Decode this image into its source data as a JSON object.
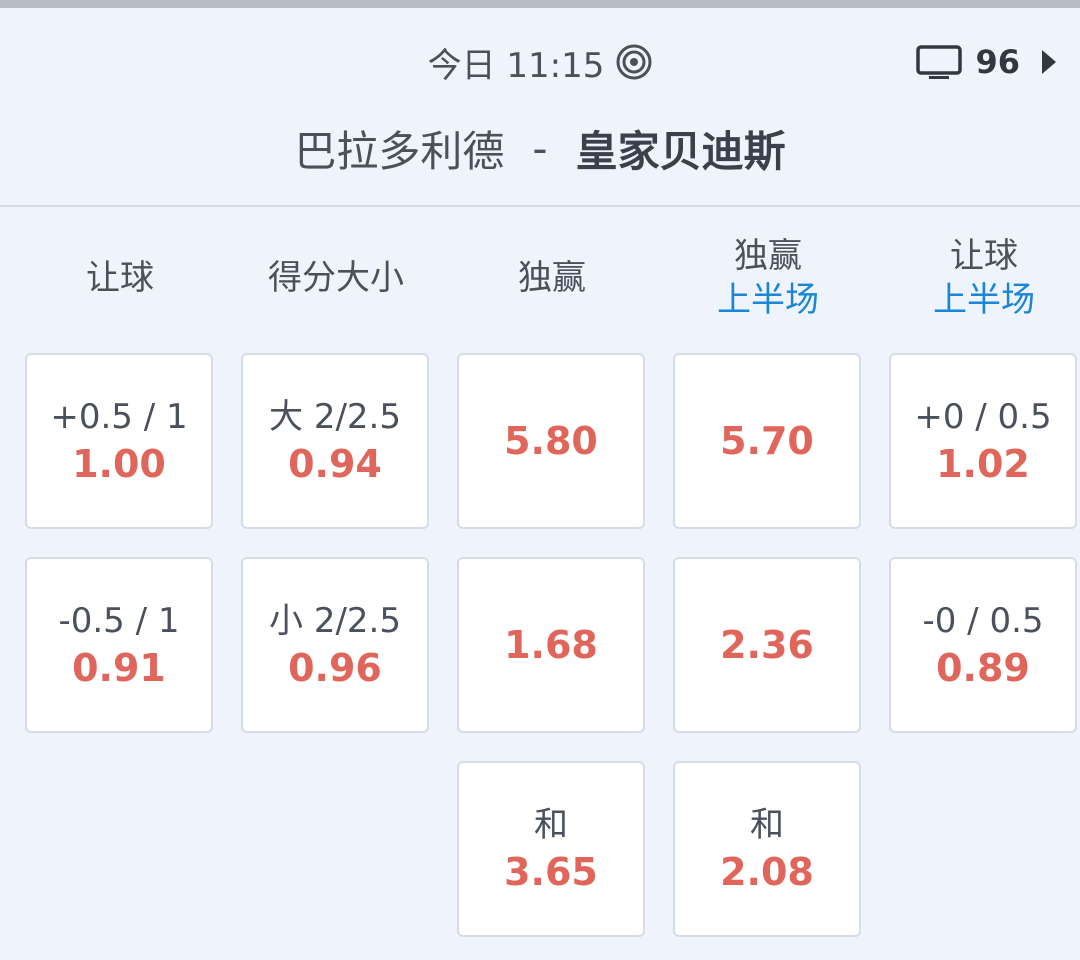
{
  "header": {
    "time": "今日 11:15",
    "tv_count": "96",
    "home_team": "巴拉多利德",
    "separator": "-",
    "away_team": "皇家贝迪斯"
  },
  "columns": [
    {
      "title": "让球",
      "sub": ""
    },
    {
      "title": "得分大小",
      "sub": ""
    },
    {
      "title": "独赢",
      "sub": ""
    },
    {
      "title": "独赢",
      "sub": "上半场"
    },
    {
      "title": "让球",
      "sub": "上半场"
    }
  ],
  "cells": {
    "r0": [
      {
        "line": "+0.5 / 1",
        "odds": "1.00"
      },
      {
        "line": "大 2/2.5",
        "odds": "0.94"
      },
      {
        "line": "",
        "odds": "5.80"
      },
      {
        "line": "",
        "odds": "5.70"
      },
      {
        "line": "+0 / 0.5",
        "odds": "1.02"
      }
    ],
    "r1": [
      {
        "line": "-0.5 / 1",
        "odds": "0.91"
      },
      {
        "line": "小 2/2.5",
        "odds": "0.96"
      },
      {
        "line": "",
        "odds": "1.68"
      },
      {
        "line": "",
        "odds": "2.36"
      },
      {
        "line": "-0 / 0.5",
        "odds": "0.89"
      }
    ],
    "r2": [
      {
        "line": "和",
        "odds": "3.65"
      },
      {
        "line": "和",
        "odds": "2.08"
      }
    ]
  },
  "colors": {
    "odds": "#e0655a",
    "sub_header": "#1a86d6",
    "background": "#eef3fc"
  },
  "icons": {
    "live": "live-radar-icon",
    "tv": "tv-icon",
    "arrow": "play-arrow-icon"
  }
}
